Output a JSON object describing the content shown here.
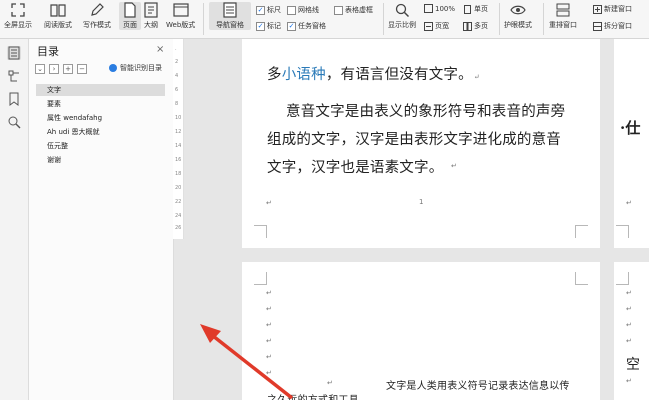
{
  "toolbar": {
    "fullscreen": "全屏显示",
    "reading": "阅读版式",
    "writing": "写作模式",
    "page": "页面",
    "outline": "大纲",
    "web": "Web版式",
    "nav_pane": "导航窗格",
    "ruler": "标尺",
    "gridlines": "网格线",
    "table_gridlines": "表格虚框",
    "marks": "标记",
    "task_pane": "任务窗格",
    "show_ratio": "显示比例",
    "zoom": "100%",
    "page_width": "页宽",
    "single_page": "单页",
    "multi_page": "多页",
    "eye_mode": "护眼模式",
    "rearrange": "重排窗口",
    "new_window": "新建窗口",
    "split_window": "拆分窗口"
  },
  "panel": {
    "title": "目录",
    "close": "×",
    "smart_toc": "智能识别目录",
    "items": [
      {
        "label": "文字"
      },
      {
        "label": "要素"
      },
      {
        "label": "属性 wendafahg"
      },
      {
        "label": "Ah udi 恩大概就"
      },
      {
        "label": "伍元整"
      },
      {
        "label": "谢谢"
      }
    ]
  },
  "document": {
    "line1_part1": "多",
    "line1_link": "小语种",
    "line1_part2": "，有语言但没有文字。",
    "para_line1": "意音文字是由表义的象形符号和表音的声旁",
    "para_line2": "组成的文字，汉字是由表形文字进化成的意音",
    "para_line3": "文字，汉字也是语素文字。",
    "page_number": "1",
    "page2_line1": "文字是人类用表义符号记录表达信息以传",
    "page2_line2": "之久远的方式和工具。",
    "right_page_char1": "·仕",
    "right_page_char2": "空"
  },
  "colors": {
    "accent": "#2a7de1",
    "link": "#2a7ab8",
    "arrow": "#e03a2a"
  }
}
